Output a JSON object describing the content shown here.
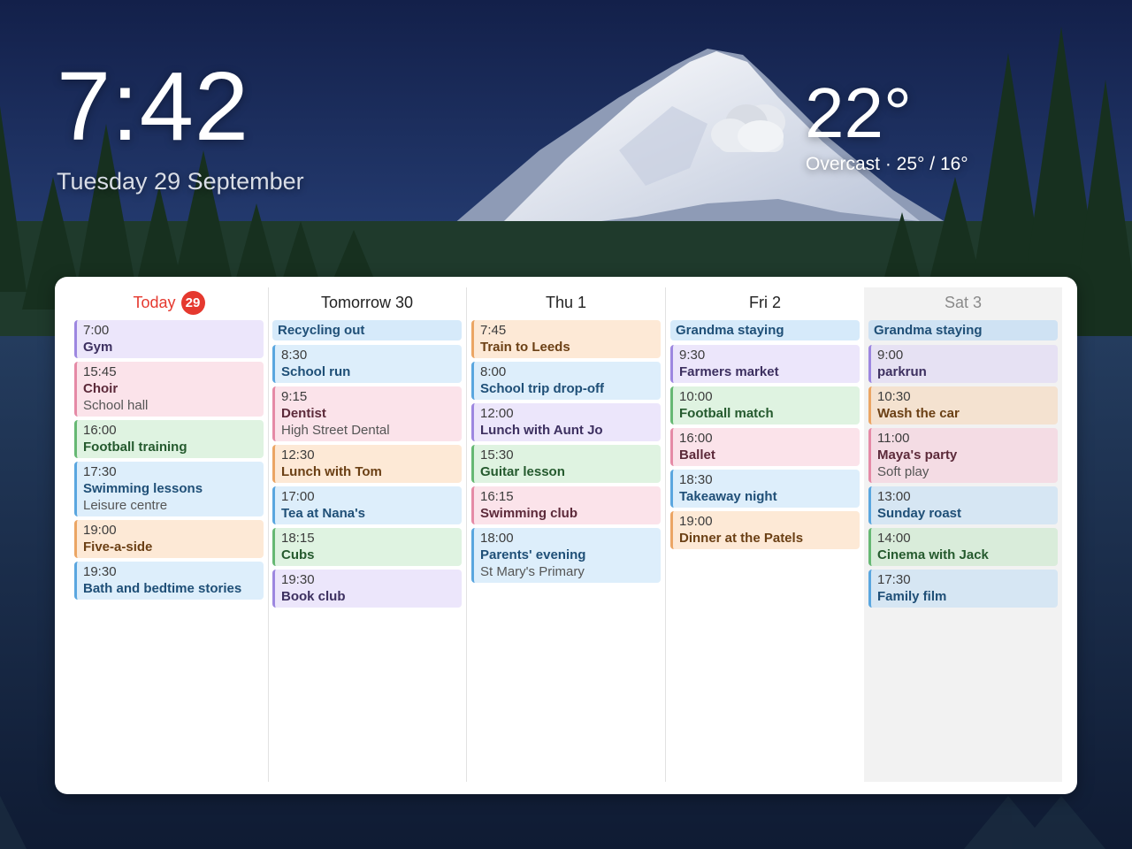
{
  "header": {
    "time": "7:42",
    "date": "Tuesday 29 September",
    "temperature": "22°",
    "condition": "Overcast · 25° / 16°",
    "weather_icon": "cloud-icon"
  },
  "columns": [
    {
      "label": "Today",
      "badge": "29",
      "events": [
        {
          "time": "7:00",
          "title": "Gym",
          "color": "purple"
        },
        {
          "time": "15:45",
          "title": "Choir",
          "location": "School hall",
          "color": "pink"
        },
        {
          "time": "16:00",
          "title": "Football training",
          "color": "green"
        },
        {
          "time": "17:30",
          "title": "Swimming lessons",
          "location": "Leisure centre",
          "color": "blue"
        },
        {
          "time": "19:00",
          "title": "Five-a-side",
          "color": "orange"
        },
        {
          "time": "19:30",
          "title": "Bath and bedtime stories",
          "color": "blue"
        }
      ]
    },
    {
      "label": "Tomorrow 30",
      "all_day": "Recycling out",
      "events": [
        {
          "time": "8:30",
          "title": "School run",
          "color": "blue"
        },
        {
          "time": "9:15",
          "title": "Dentist",
          "location": "High Street Dental",
          "color": "pink"
        },
        {
          "time": "12:30",
          "title": "Lunch with Tom",
          "color": "orange"
        },
        {
          "time": "17:00",
          "title": "Tea at Nana's",
          "color": "blue"
        },
        {
          "time": "18:15",
          "title": "Cubs",
          "color": "green"
        },
        {
          "time": "19:30",
          "title": "Book club",
          "color": "purple"
        }
      ]
    },
    {
      "label": "Thu 1",
      "events": [
        {
          "time": "7:45",
          "title": "Train to Leeds",
          "color": "orange"
        },
        {
          "time": "8:00",
          "title": "School trip drop-off",
          "color": "blue"
        },
        {
          "time": "12:00",
          "title": "Lunch with Aunt Jo",
          "color": "purple"
        },
        {
          "time": "15:30",
          "title": "Guitar lesson",
          "color": "green"
        },
        {
          "time": "16:15",
          "title": "Swimming club",
          "color": "pink"
        },
        {
          "time": "18:00",
          "title": "Parents' evening",
          "location": "St Mary's Primary",
          "color": "blue"
        }
      ]
    },
    {
      "label": "Fri 2",
      "all_day": "Grandma staying",
      "events": [
        {
          "time": "9:30",
          "title": "Farmers market",
          "color": "purple"
        },
        {
          "time": "10:00",
          "title": "Football match",
          "color": "green"
        },
        {
          "time": "16:00",
          "title": "Ballet",
          "color": "pink"
        },
        {
          "time": "18:30",
          "title": "Takeaway night",
          "color": "blue"
        },
        {
          "time": "19:00",
          "title": "Dinner at the Patels",
          "color": "orange"
        }
      ]
    },
    {
      "label": "Sat 3",
      "all_day": "Grandma staying",
      "events": [
        {
          "time": "9:00",
          "title": "parkrun",
          "color": "purple"
        },
        {
          "time": "10:30",
          "title": "Wash the car",
          "color": "orange"
        },
        {
          "time": "11:00",
          "title": "Maya's party",
          "location": "Soft play",
          "color": "pink"
        },
        {
          "time": "13:00",
          "title": "Sunday roast",
          "color": "blue"
        },
        {
          "time": "14:00",
          "title": "Cinema with Jack",
          "color": "green"
        },
        {
          "time": "17:30",
          "title": "Family film",
          "color": "blue"
        }
      ]
    }
  ]
}
